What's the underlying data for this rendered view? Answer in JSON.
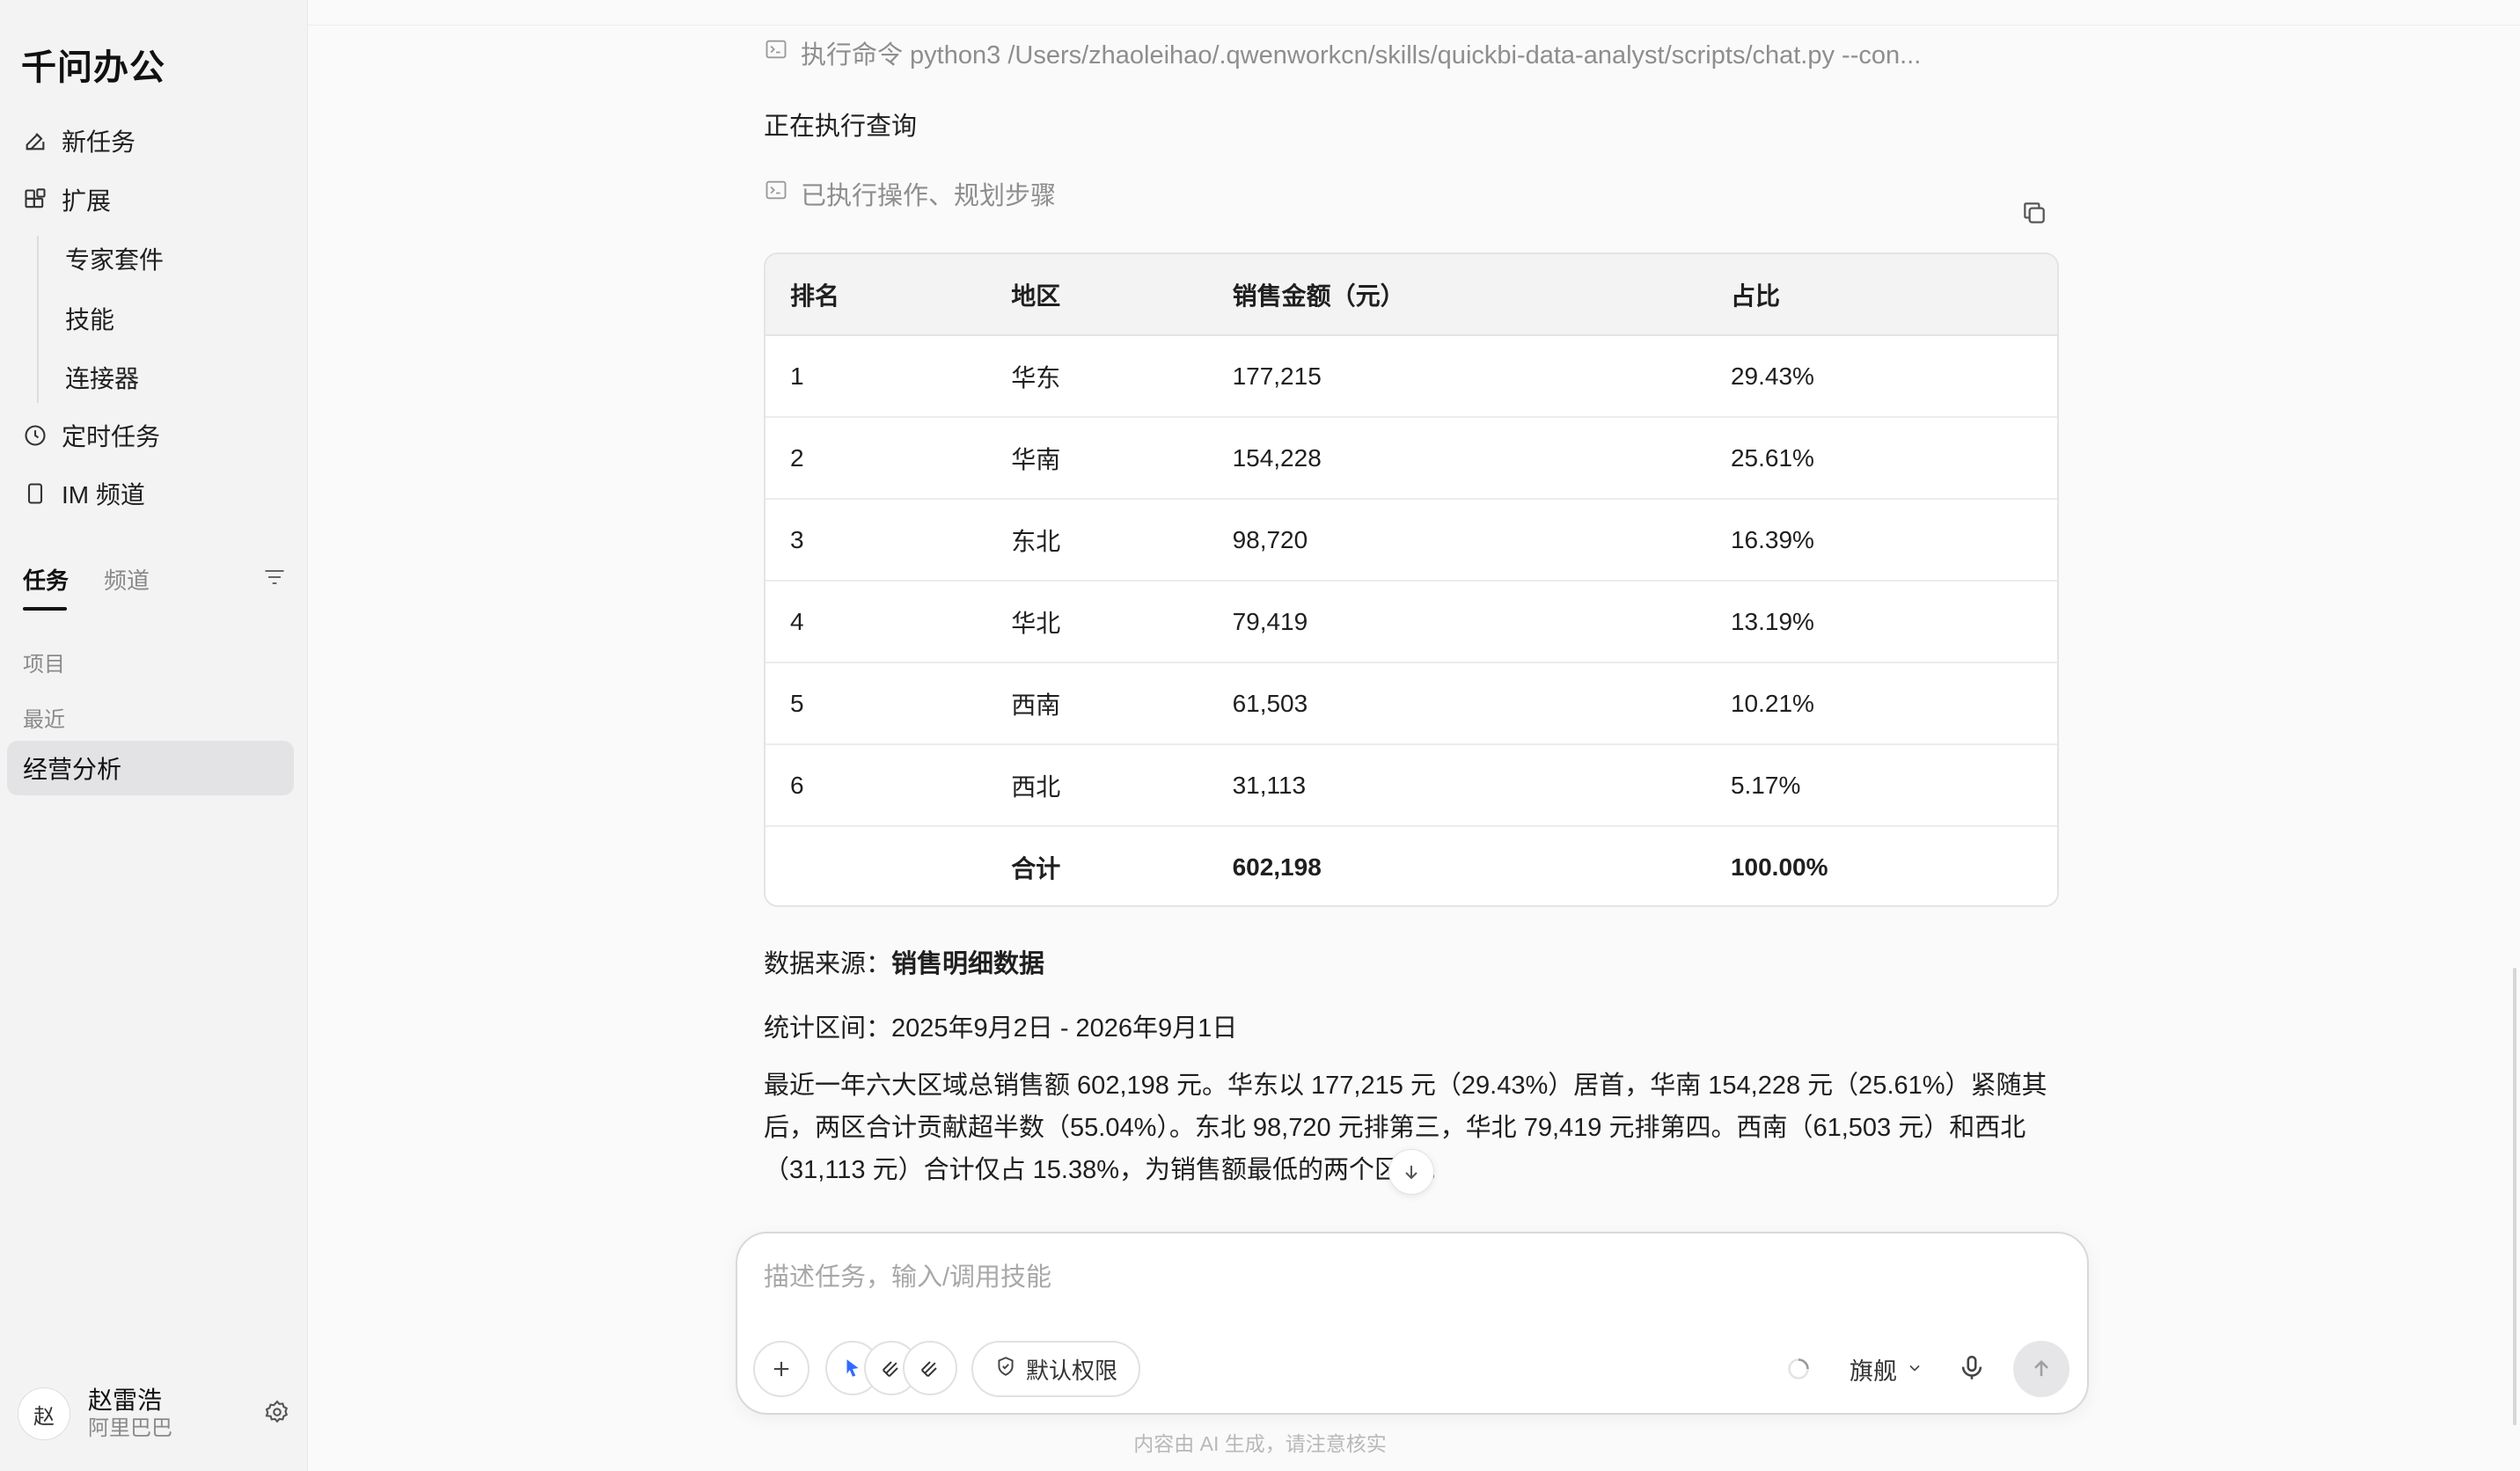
{
  "app": {
    "title": "千问办公"
  },
  "sidebar": {
    "nav": [
      {
        "label": "新任务",
        "icon": "edit-icon"
      },
      {
        "label": "扩展",
        "icon": "extensions-icon"
      }
    ],
    "sub_items": [
      "专家套件",
      "技能",
      "连接器"
    ],
    "nav2": [
      {
        "label": "定时任务",
        "icon": "clock-icon"
      },
      {
        "label": "IM 频道",
        "icon": "phone-icon"
      }
    ],
    "tabs": {
      "active": "任务",
      "inactive": "频道"
    },
    "section_projects": "项目",
    "section_recent": "最近",
    "recent_items": [
      "经营分析"
    ],
    "user": {
      "avatar": "赵",
      "name": "赵雷浩",
      "org": "阿里巴巴"
    }
  },
  "chat": {
    "command": "执行命令 python3 /Users/zhaoleihao/.qwenworkcn/skills/quickbi-data-analyst/scripts/chat.py --con...",
    "status": "正在执行查询",
    "ops": "已执行操作、规划步骤",
    "table": {
      "headers": [
        "排名",
        "地区",
        "销售金额（元）",
        "占比"
      ],
      "rows": [
        [
          "1",
          "华东",
          "177,215",
          "29.43%"
        ],
        [
          "2",
          "华南",
          "154,228",
          "25.61%"
        ],
        [
          "3",
          "东北",
          "98,720",
          "16.39%"
        ],
        [
          "4",
          "华北",
          "79,419",
          "13.19%"
        ],
        [
          "5",
          "西南",
          "61,503",
          "10.21%"
        ],
        [
          "6",
          "西北",
          "31,113",
          "5.17%"
        ]
      ],
      "total": [
        "",
        "合计",
        "602,198",
        "100.00%"
      ]
    },
    "source_label": "数据来源：",
    "source_value": "销售明细数据",
    "period": "统计区间：2025年9月2日 - 2026年9月1日",
    "summary": "最近一年六大区域总销售额 602,198 元。华东以 177,215 元（29.43%）居首，华南 154,228 元（25.61%）紧随其后，两区合计贡献超半数（55.04%）。东北 98,720 元排第三，华北 79,419 元排第四。西南（61,503 元）和西北（31,113 元）合计仅占 15.38%，为销售额最低的两个区域。"
  },
  "composer": {
    "placeholder": "描述任务，输入/调用技能",
    "permission": "默认权限",
    "model": "旗舰"
  },
  "footer": {
    "note": "内容由 AI 生成，请注意核实"
  },
  "colors": {
    "accent": "#2f6bff",
    "sidebar_bg": "#f3f3f4",
    "selected_bg": "#e3e3e6"
  }
}
